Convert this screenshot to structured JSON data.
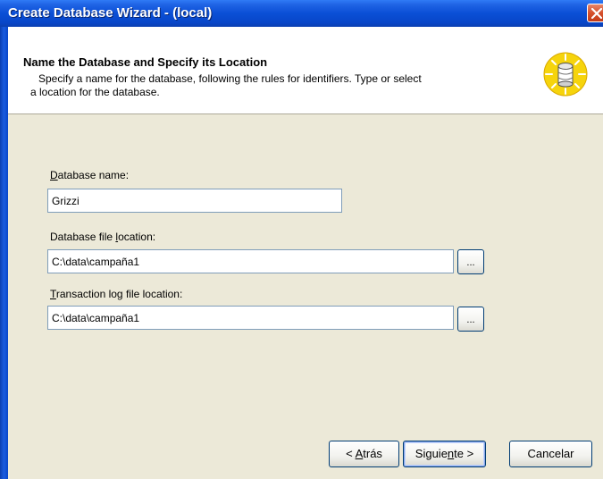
{
  "window": {
    "title": "Create Database Wizard - (local)"
  },
  "header": {
    "title": "Name the Database and Specify its Location",
    "description_line1": "Specify a name for the database, following the rules for identifiers. Type or select",
    "description_line2": "a location for the database.",
    "icon": "database-icon"
  },
  "fields": {
    "db_name": {
      "label_pre": "",
      "label_key": "D",
      "label_post": "atabase name:",
      "value": "Grizzi"
    },
    "db_file": {
      "label_pre": "Database file ",
      "label_key": "l",
      "label_post": "ocation:",
      "value": "C:\\data\\campaña1",
      "browse": "..."
    },
    "log_file": {
      "label_pre": "",
      "label_key": "T",
      "label_post": "ransaction log file location:",
      "value": "C:\\data\\campaña1",
      "browse": "..."
    }
  },
  "buttons": {
    "back": {
      "pre": "< ",
      "key": "A",
      "post": "trás"
    },
    "next": {
      "pre": "Siguie",
      "key": "n",
      "post": "te >"
    },
    "cancel": "Cancelar"
  },
  "colors": {
    "titlebar": "#0a4fd6",
    "dialog_bg": "#ece9d8",
    "header_bg": "#ffffff",
    "close_button": "#d5502c"
  }
}
